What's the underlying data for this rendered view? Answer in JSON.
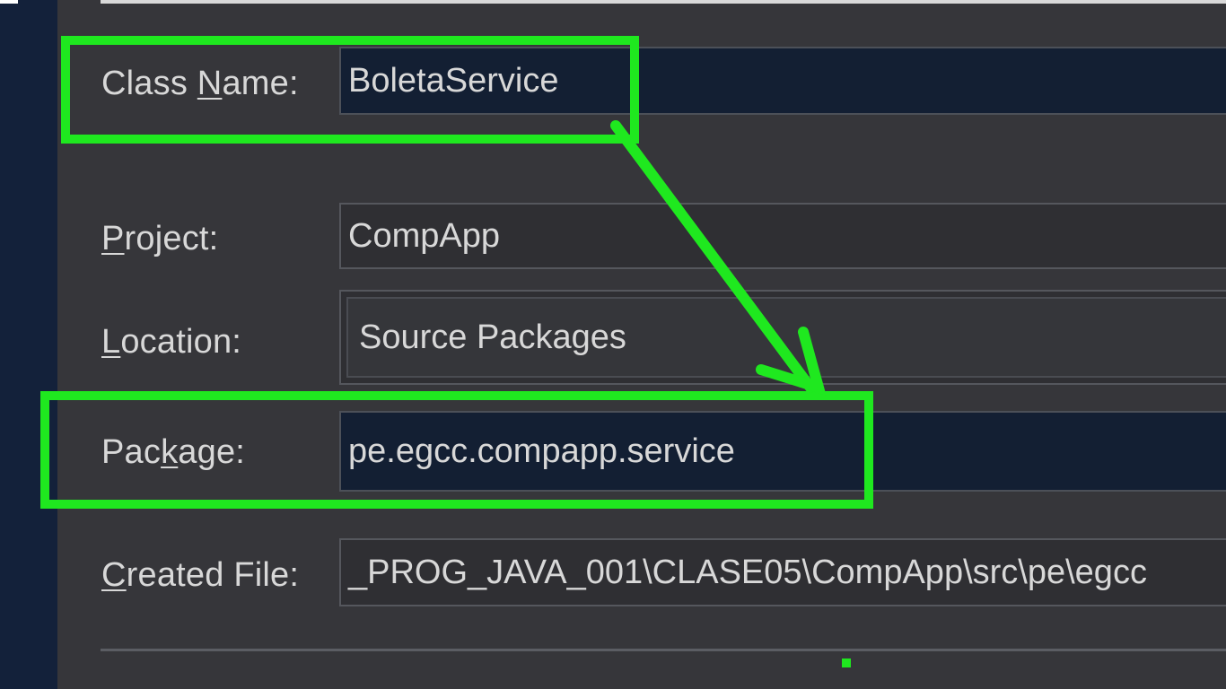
{
  "form": {
    "class_name": {
      "label_pre": "Class ",
      "label_mnemonic": "N",
      "label_post": "ame:",
      "value": "BoletaService"
    },
    "project": {
      "label_pre": "",
      "label_mnemonic": "P",
      "label_post": "roject:",
      "value": "CompApp"
    },
    "location": {
      "label_pre": "",
      "label_mnemonic": "L",
      "label_post": "ocation:",
      "value": "Source Packages"
    },
    "package": {
      "label_pre": "Pac",
      "label_mnemonic": "k",
      "label_post": "age:",
      "value": "pe.egcc.compapp.service"
    },
    "created_file": {
      "label_pre": "",
      "label_mnemonic": "C",
      "label_post": "reated File:",
      "value": "_PROG_JAVA_001\\CLASE05\\CompApp\\src\\pe\\egcc"
    }
  },
  "annotation": {
    "highlight_color": "#1fe81f",
    "arrow_from": "class-name-field",
    "arrow_to": "package-field"
  },
  "colors": {
    "dialog_bg": "#36363a",
    "editable_field_bg": "#131f33",
    "readonly_field_bg": "#2f2f33",
    "text": "#d8d8d8",
    "side_strip": "#13213a"
  }
}
